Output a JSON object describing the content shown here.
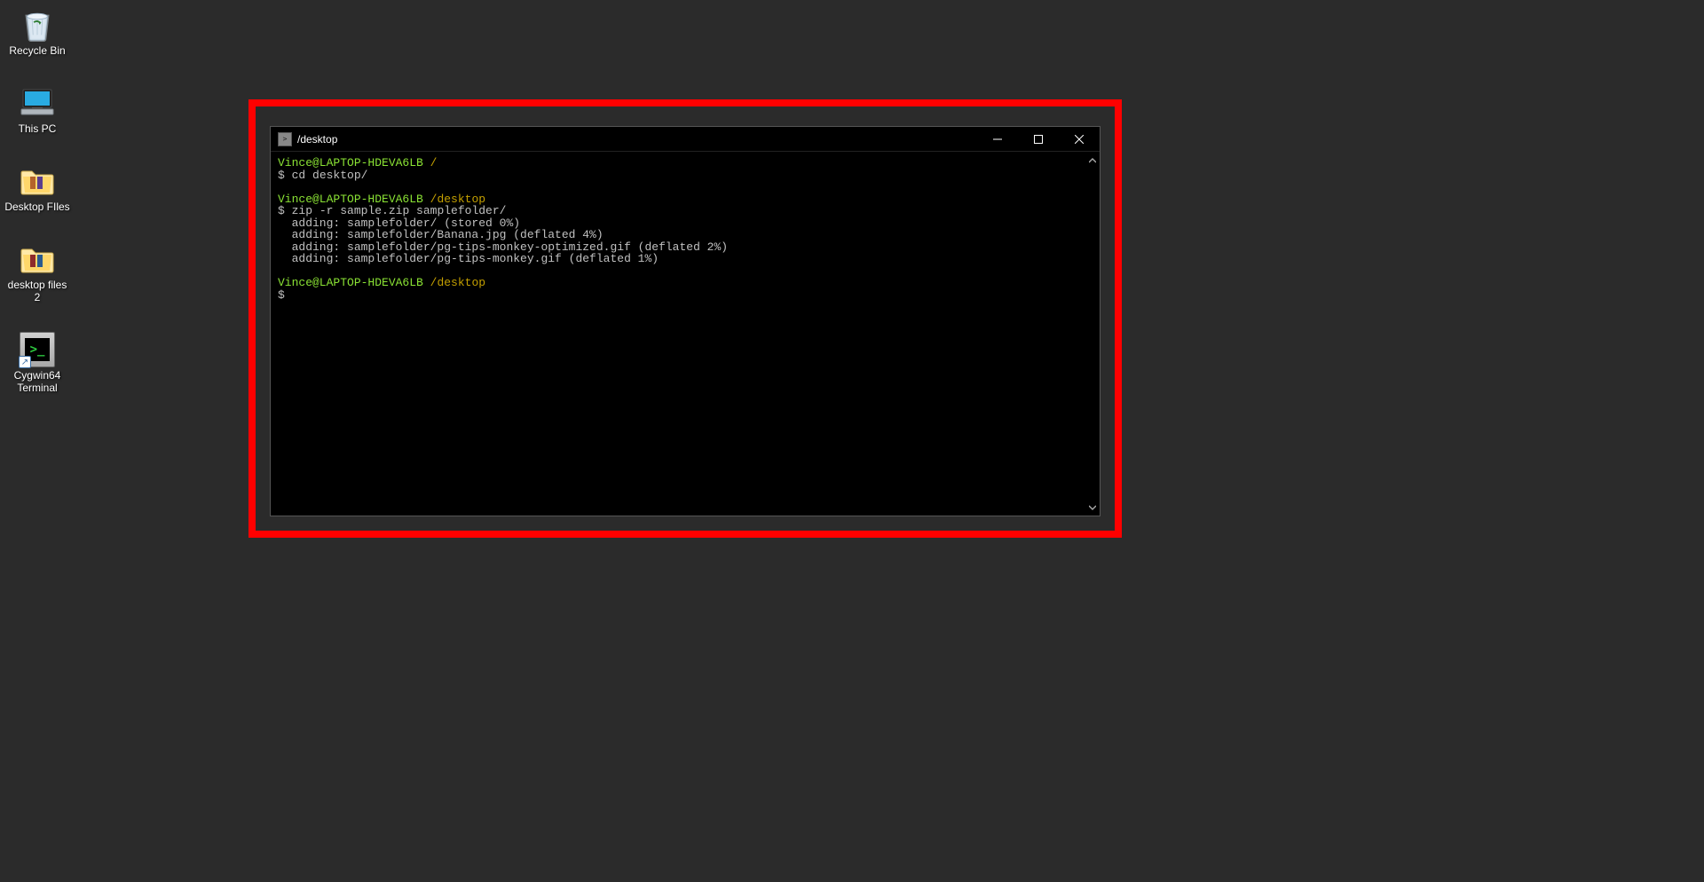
{
  "desktop": {
    "icons": [
      {
        "name": "recycle-bin",
        "label": "Recycle Bin"
      },
      {
        "name": "this-pc",
        "label": "This PC"
      },
      {
        "name": "desktop-files",
        "label": "Desktop FIles"
      },
      {
        "name": "desktop-files-2",
        "label": "desktop files 2"
      },
      {
        "name": "cygwin-terminal",
        "label": "Cygwin64 Terminal"
      }
    ]
  },
  "terminal": {
    "title": "/desktop",
    "prompts": [
      {
        "userhost": "Vince@LAPTOP-HDEVA6LB",
        "path": "/",
        "command": "cd desktop/"
      },
      {
        "userhost": "Vince@LAPTOP-HDEVA6LB",
        "path": "/desktop",
        "command": "zip -r sample.zip samplefolder/"
      },
      {
        "userhost": "Vince@LAPTOP-HDEVA6LB",
        "path": "/desktop",
        "command": ""
      }
    ],
    "output": [
      "  adding: samplefolder/ (stored 0%)",
      "  adding: samplefolder/Banana.jpg (deflated 4%)",
      "  adding: samplefolder/pg-tips-monkey-optimized.gif (deflated 2%)",
      "  adding: samplefolder/pg-tips-monkey.gif (deflated 1%)"
    ],
    "prompt_symbol": "$"
  },
  "colors": {
    "desktop_bg": "#2b2b2b",
    "highlight_border": "#ff0000",
    "prompt_user": "#8ae234",
    "prompt_path": "#c4a000",
    "terminal_fg": "#c0c0c0"
  }
}
